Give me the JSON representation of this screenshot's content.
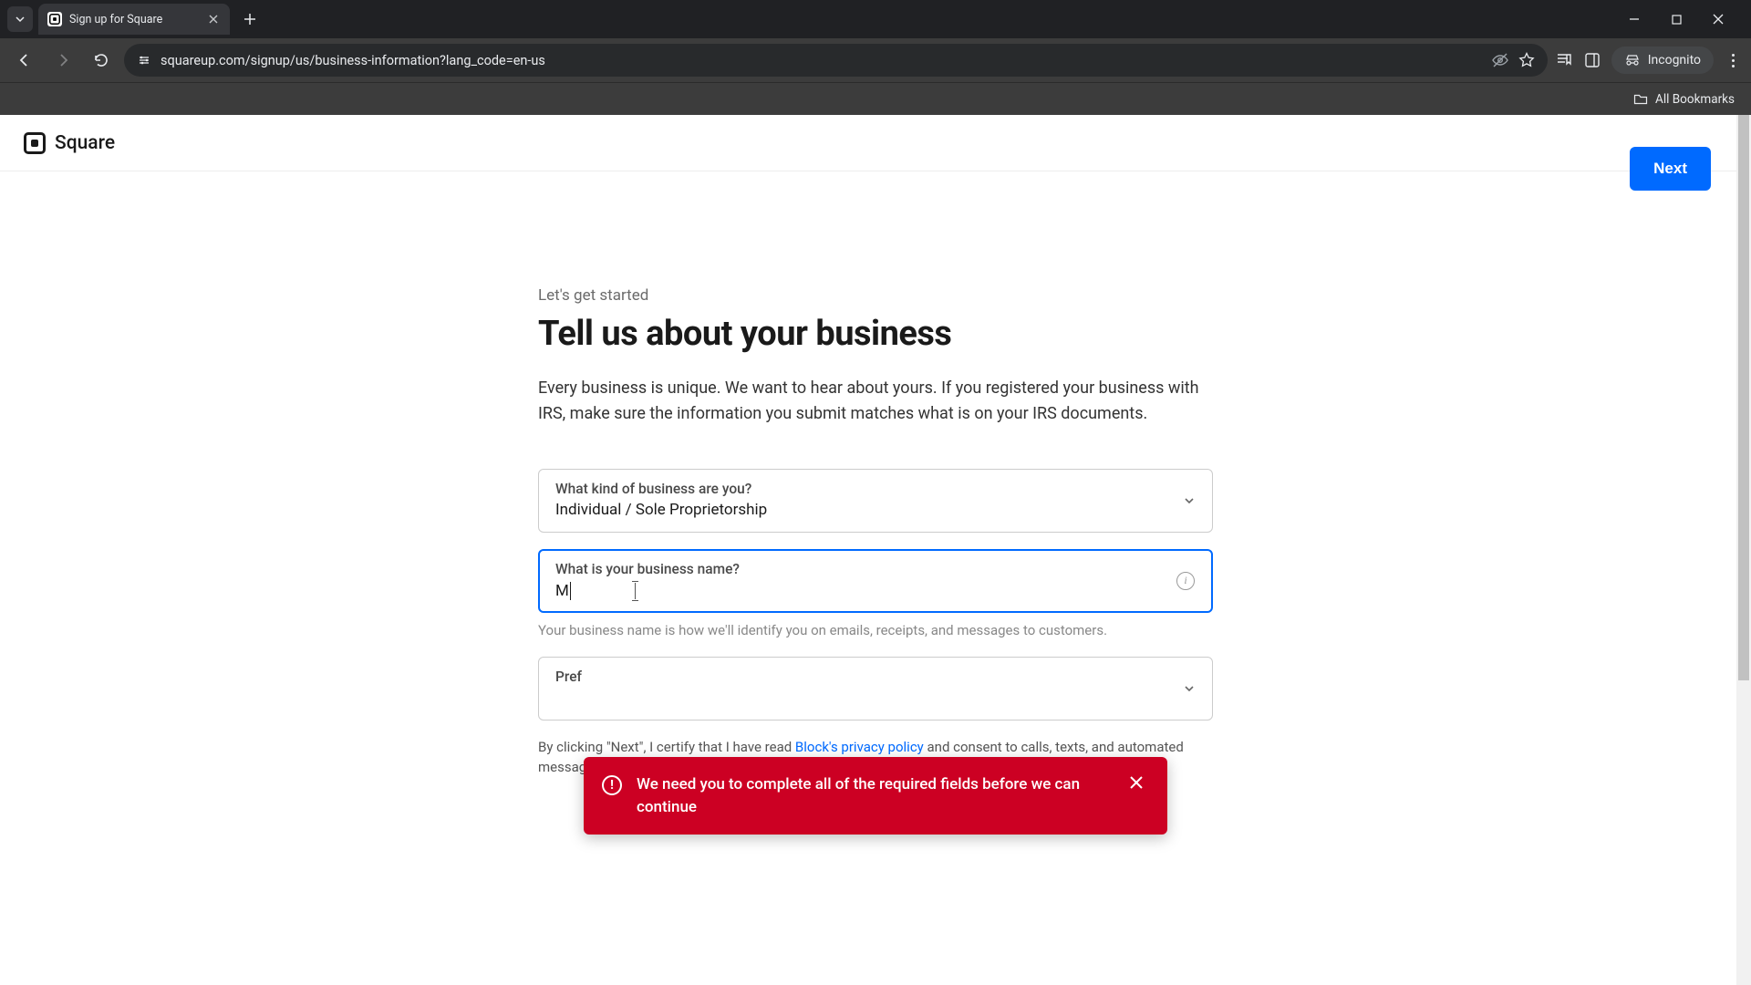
{
  "browser": {
    "tab_title": "Sign up for Square",
    "url": "squareup.com/signup/us/business-information?lang_code=en-us",
    "incognito_label": "Incognito",
    "all_bookmarks": "All Bookmarks"
  },
  "app": {
    "brand": "Square",
    "next_button": "Next"
  },
  "page": {
    "eyebrow": "Let's get started",
    "headline": "Tell us about your business",
    "intro": "Every business is unique. We want to hear about yours. If you registered your business with IRS, make sure the information you submit matches what is on your IRS documents."
  },
  "fields": {
    "business_type": {
      "label": "What kind of business are you?",
      "value": "Individual / Sole Proprietorship"
    },
    "business_name": {
      "label": "What is your business name?",
      "value": "M",
      "helper": "Your business name is how we'll identify you on emails, receipts, and messages to customers."
    },
    "preferred_language": {
      "label": "Pref"
    }
  },
  "consent": {
    "prefix": "By clicking \"Next\", I certify that I have read ",
    "link": "Block's privacy policy",
    "middle": " and consent to calls, texts, and automated messages from Block, Inc. regarding my accounts."
  },
  "error": {
    "message": "We need you to complete all of the required fields before we can continue"
  }
}
